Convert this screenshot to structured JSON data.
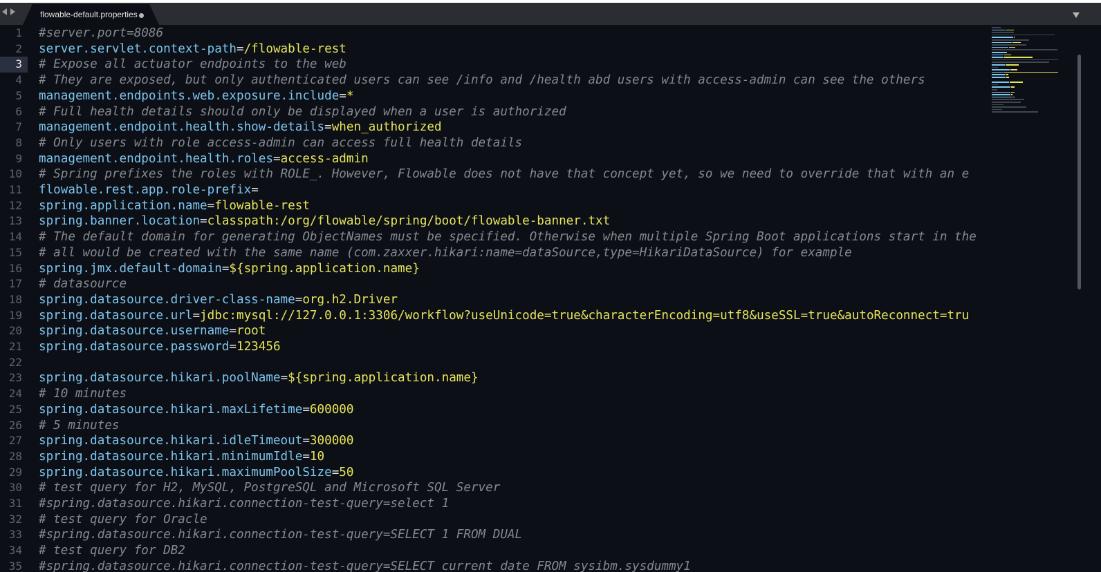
{
  "tab": {
    "title": "flowable-default.properties",
    "dirty": true
  },
  "editor": {
    "current_line": 3,
    "colors": {
      "background": "#0c1016",
      "key": "#7ec4ef",
      "value": "#e7e35a",
      "comment": "#84888f",
      "operator": "#e8e8e8"
    },
    "lines": [
      {
        "num": "1",
        "type": "comment",
        "comment": "#server.port=8086"
      },
      {
        "num": "2",
        "type": "prop",
        "key": "server.servlet.context-path",
        "value": "/flowable-rest"
      },
      {
        "num": "3",
        "type": "comment",
        "comment": "# Expose all actuator endpoints to the web"
      },
      {
        "num": "4",
        "type": "comment",
        "comment": "# They are exposed, but only authenticated users can see /info and /health abd users with access-admin can see the others"
      },
      {
        "num": "5",
        "type": "prop",
        "key": "management.endpoints.web.exposure.include",
        "value": "*"
      },
      {
        "num": "6",
        "type": "comment",
        "comment": "# Full health details should only be displayed when a user is authorized"
      },
      {
        "num": "7",
        "type": "prop",
        "key": "management.endpoint.health.show-details",
        "value": "when_authorized"
      },
      {
        "num": "8",
        "type": "comment",
        "comment": "# Only users with role access-admin can access full health details"
      },
      {
        "num": "9",
        "type": "prop",
        "key": "management.endpoint.health.roles",
        "value": "access-admin"
      },
      {
        "num": "10",
        "type": "comment",
        "comment": "# Spring prefixes the roles with ROLE_. However, Flowable does not have that concept yet, so we need to override that with an e"
      },
      {
        "num": "11",
        "type": "prop",
        "key": "flowable.rest.app.role-prefix",
        "value": ""
      },
      {
        "num": "12",
        "type": "prop",
        "key": "spring.application.name",
        "value": "flowable-rest"
      },
      {
        "num": "13",
        "type": "prop",
        "key": "spring.banner.location",
        "value": "classpath:/org/flowable/spring/boot/flowable-banner.txt"
      },
      {
        "num": "14",
        "type": "comment",
        "comment": "# The default domain for generating ObjectNames must be specified. Otherwise when multiple Spring Boot applications start in the"
      },
      {
        "num": "15",
        "type": "comment",
        "comment": "# all would be created with the same name (com.zaxxer.hikari:name=dataSource,type=HikariDataSource) for example"
      },
      {
        "num": "16",
        "type": "prop",
        "key": "spring.jmx.default-domain",
        "value": "${spring.application.name}"
      },
      {
        "num": "17",
        "type": "comment",
        "comment": "# datasource"
      },
      {
        "num": "18",
        "type": "prop",
        "key": "spring.datasource.driver-class-name",
        "value": "org.h2.Driver"
      },
      {
        "num": "19",
        "type": "prop",
        "key": "spring.datasource.url",
        "value": "jdbc:mysql://127.0.0.1:3306/workflow?useUnicode=true&characterEncoding=utf8&useSSL=true&autoReconnect=tru"
      },
      {
        "num": "20",
        "type": "prop",
        "key": "spring.datasource.username",
        "value": "root"
      },
      {
        "num": "21",
        "type": "prop",
        "key": "spring.datasource.password",
        "value": "123456"
      },
      {
        "num": "22",
        "type": "blank"
      },
      {
        "num": "23",
        "type": "prop",
        "key": "spring.datasource.hikari.poolName",
        "value": "${spring.application.name}"
      },
      {
        "num": "24",
        "type": "comment",
        "comment": "# 10 minutes"
      },
      {
        "num": "25",
        "type": "prop",
        "key": "spring.datasource.hikari.maxLifetime",
        "value": "600000"
      },
      {
        "num": "26",
        "type": "comment",
        "comment": "# 5 minutes"
      },
      {
        "num": "27",
        "type": "prop",
        "key": "spring.datasource.hikari.idleTimeout",
        "value": "300000"
      },
      {
        "num": "28",
        "type": "prop",
        "key": "spring.datasource.hikari.minimumIdle",
        "value": "10"
      },
      {
        "num": "29",
        "type": "prop",
        "key": "spring.datasource.hikari.maximumPoolSize",
        "value": "50"
      },
      {
        "num": "30",
        "type": "comment",
        "comment": "# test query for H2, MySQL, PostgreSQL and Microsoft SQL Server"
      },
      {
        "num": "31",
        "type": "comment",
        "comment": "#spring.datasource.hikari.connection-test-query=select 1"
      },
      {
        "num": "32",
        "type": "comment",
        "comment": "# test query for Oracle"
      },
      {
        "num": "33",
        "type": "comment",
        "comment": "#spring.datasource.hikari.connection-test-query=SELECT 1 FROM DUAL"
      },
      {
        "num": "34",
        "type": "comment",
        "comment": "# test query for DB2"
      },
      {
        "num": "35",
        "type": "comment",
        "comment": "#spring.datasource.hikari.connection-test-query=SELECT current date FROM sysibm.sysdummy1"
      }
    ]
  }
}
